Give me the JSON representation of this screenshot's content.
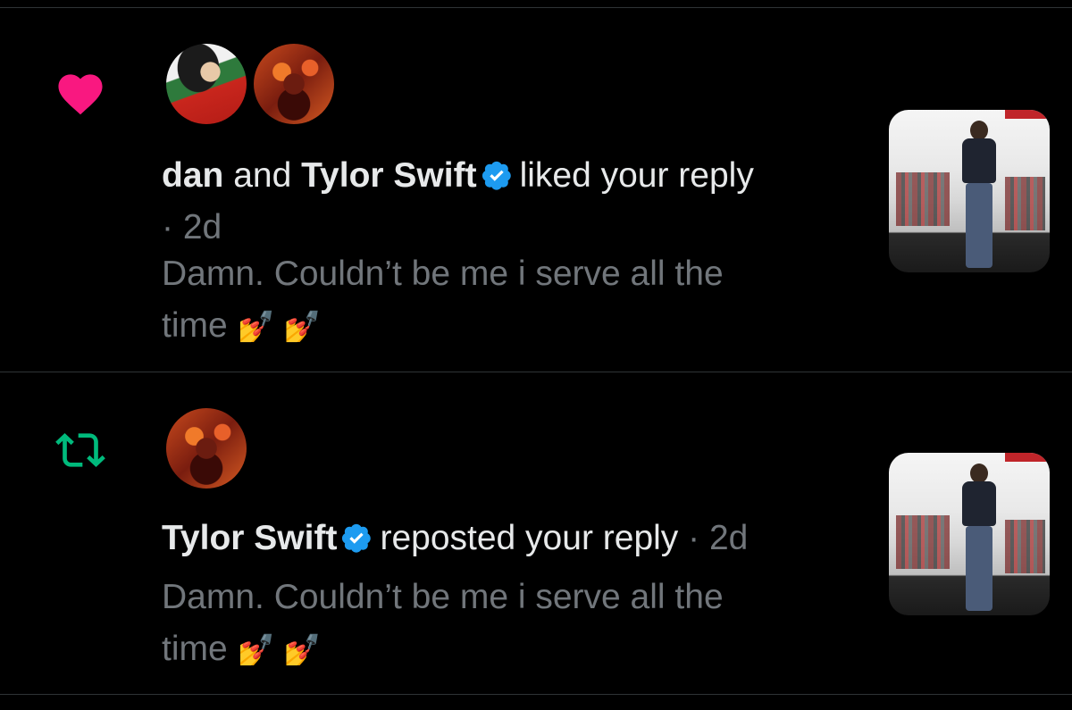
{
  "notifications": [
    {
      "type": "like",
      "icon": "heart-icon",
      "icon_color": "#f91880",
      "avatars": [
        "dan-avatar",
        "tylor-swift-avatar"
      ],
      "actor_1": "dan",
      "conjunction": "and",
      "actor_2": "Tylor Swift",
      "verified_color": "#1d9bf0",
      "action": "liked your reply",
      "time": "· 2d",
      "reply_text": "Damn. Couldn’t be me i serve all the time",
      "reply_line_1": "Damn. Couldn’t be me i serve all the",
      "reply_line_2": "time",
      "emoji": "💅 💅"
    },
    {
      "type": "repost",
      "icon": "repost-icon",
      "icon_color": "#00ba7c",
      "avatars": [
        "tylor-swift-avatar"
      ],
      "actor_1": "Tylor Swift",
      "verified_color": "#1d9bf0",
      "action": "reposted your reply",
      "time": "· 2d",
      "reply_text": "Damn. Couldn’t be me i serve all the time",
      "reply_line_1": "Damn. Couldn’t be me i serve all the",
      "reply_line_2": "time",
      "emoji": "💅 💅"
    }
  ]
}
